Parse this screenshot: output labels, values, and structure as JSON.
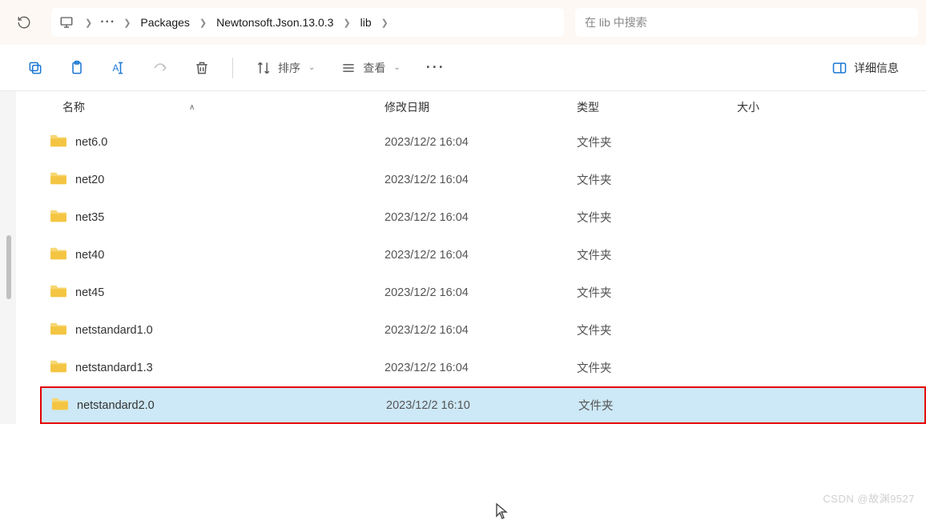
{
  "breadcrumb": {
    "overflow": "···",
    "items": [
      "Packages",
      "Newtonsoft.Json.13.0.3",
      "lib"
    ]
  },
  "search": {
    "placeholder": "在 lib 中搜索"
  },
  "toolbar": {
    "sort_label": "排序",
    "view_label": "查看",
    "details_label": "详细信息"
  },
  "columns": {
    "name": "名称",
    "date": "修改日期",
    "type": "类型",
    "size": "大小"
  },
  "rows": [
    {
      "name": "net6.0",
      "date": "2023/12/2 16:04",
      "type": "文件夹",
      "size": "",
      "selected": false,
      "highlighted": false
    },
    {
      "name": "net20",
      "date": "2023/12/2 16:04",
      "type": "文件夹",
      "size": "",
      "selected": false,
      "highlighted": false
    },
    {
      "name": "net35",
      "date": "2023/12/2 16:04",
      "type": "文件夹",
      "size": "",
      "selected": false,
      "highlighted": false
    },
    {
      "name": "net40",
      "date": "2023/12/2 16:04",
      "type": "文件夹",
      "size": "",
      "selected": false,
      "highlighted": false
    },
    {
      "name": "net45",
      "date": "2023/12/2 16:04",
      "type": "文件夹",
      "size": "",
      "selected": false,
      "highlighted": false
    },
    {
      "name": "netstandard1.0",
      "date": "2023/12/2 16:04",
      "type": "文件夹",
      "size": "",
      "selected": false,
      "highlighted": false
    },
    {
      "name": "netstandard1.3",
      "date": "2023/12/2 16:04",
      "type": "文件夹",
      "size": "",
      "selected": false,
      "highlighted": false
    },
    {
      "name": "netstandard2.0",
      "date": "2023/12/2 16:10",
      "type": "文件夹",
      "size": "",
      "selected": true,
      "highlighted": true
    }
  ],
  "watermark": "CSDN @故渊9527"
}
